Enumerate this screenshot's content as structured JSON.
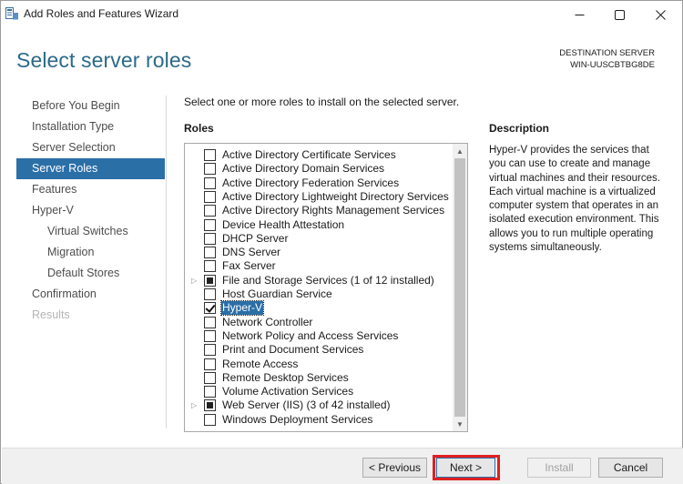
{
  "window": {
    "title": "Add Roles and Features Wizard",
    "controls": {
      "minimize": "—",
      "maximize": "☐",
      "close": "✕"
    }
  },
  "header": {
    "title": "Select server roles",
    "destination_label": "DESTINATION SERVER",
    "destination_server": "WIN-UUSCBTBG8DE"
  },
  "nav": {
    "items": [
      {
        "label": "Before You Begin",
        "state": "normal"
      },
      {
        "label": "Installation Type",
        "state": "normal"
      },
      {
        "label": "Server Selection",
        "state": "normal"
      },
      {
        "label": "Server Roles",
        "state": "active"
      },
      {
        "label": "Features",
        "state": "normal"
      },
      {
        "label": "Hyper-V",
        "state": "normal"
      },
      {
        "label": "Virtual Switches",
        "state": "sub"
      },
      {
        "label": "Migration",
        "state": "sub"
      },
      {
        "label": "Default Stores",
        "state": "sub"
      },
      {
        "label": "Confirmation",
        "state": "normal"
      },
      {
        "label": "Results",
        "state": "disabled"
      }
    ]
  },
  "main": {
    "instruction": "Select one or more roles to install on the selected server.",
    "roles_heading": "Roles",
    "roles": [
      {
        "label": "Active Directory Certificate Services",
        "state": "unchecked",
        "expandable": false,
        "selected": false
      },
      {
        "label": "Active Directory Domain Services",
        "state": "unchecked",
        "expandable": false,
        "selected": false
      },
      {
        "label": "Active Directory Federation Services",
        "state": "unchecked",
        "expandable": false,
        "selected": false
      },
      {
        "label": "Active Directory Lightweight Directory Services",
        "state": "unchecked",
        "expandable": false,
        "selected": false
      },
      {
        "label": "Active Directory Rights Management Services",
        "state": "unchecked",
        "expandable": false,
        "selected": false
      },
      {
        "label": "Device Health Attestation",
        "state": "unchecked",
        "expandable": false,
        "selected": false
      },
      {
        "label": "DHCP Server",
        "state": "unchecked",
        "expandable": false,
        "selected": false
      },
      {
        "label": "DNS Server",
        "state": "unchecked",
        "expandable": false,
        "selected": false
      },
      {
        "label": "Fax Server",
        "state": "unchecked",
        "expandable": false,
        "selected": false
      },
      {
        "label": "File and Storage Services (1 of 12 installed)",
        "state": "partial",
        "expandable": true,
        "selected": false
      },
      {
        "label": "Host Guardian Service",
        "state": "unchecked",
        "expandable": false,
        "selected": false
      },
      {
        "label": "Hyper-V",
        "state": "checked",
        "expandable": false,
        "selected": true
      },
      {
        "label": "Network Controller",
        "state": "unchecked",
        "expandable": false,
        "selected": false
      },
      {
        "label": "Network Policy and Access Services",
        "state": "unchecked",
        "expandable": false,
        "selected": false
      },
      {
        "label": "Print and Document Services",
        "state": "unchecked",
        "expandable": false,
        "selected": false
      },
      {
        "label": "Remote Access",
        "state": "unchecked",
        "expandable": false,
        "selected": false
      },
      {
        "label": "Remote Desktop Services",
        "state": "unchecked",
        "expandable": false,
        "selected": false
      },
      {
        "label": "Volume Activation Services",
        "state": "unchecked",
        "expandable": false,
        "selected": false
      },
      {
        "label": "Web Server (IIS) (3 of 42 installed)",
        "state": "partial",
        "expandable": true,
        "selected": false
      },
      {
        "label": "Windows Deployment Services",
        "state": "unchecked",
        "expandable": false,
        "selected": false
      }
    ],
    "description_heading": "Description",
    "description_text": "Hyper-V provides the services that you can use to create and manage virtual machines and their resources. Each virtual machine is a virtualized computer system that operates in an isolated execution environment. This allows you to run multiple operating systems simultaneously."
  },
  "footer": {
    "previous_label": "< Previous",
    "next_label": "Next >",
    "install_label": "Install",
    "cancel_label": "Cancel"
  },
  "colors": {
    "accent": "#2b6fa7",
    "title_blue": "#2b6a88",
    "highlight_red": "#e02020"
  }
}
